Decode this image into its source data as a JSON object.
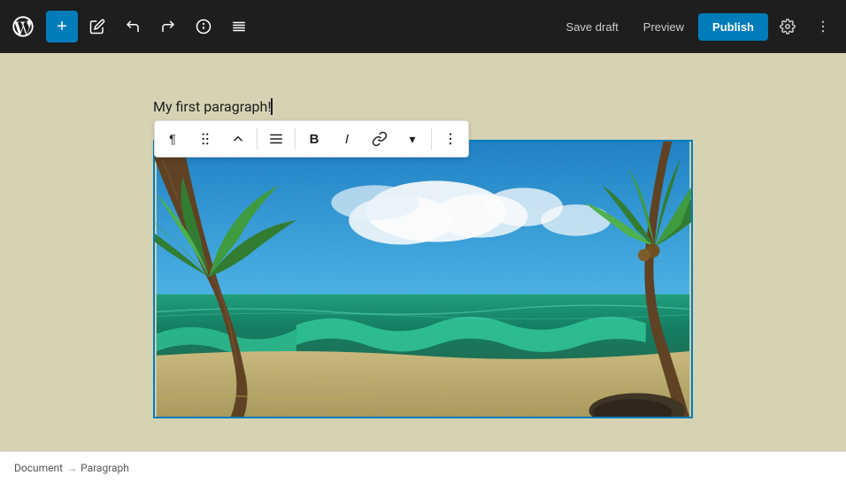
{
  "toolbar": {
    "add_label": "+",
    "save_draft_label": "Save draft",
    "preview_label": "Preview",
    "publish_label": "Publish"
  },
  "block_toolbar": {
    "paragraph_icon": "¶",
    "drag_icon": "⠿",
    "align_icon": "≡",
    "bold_icon": "B",
    "italic_icon": "I",
    "link_icon": "🔗",
    "more_icon": "⋮"
  },
  "content": {
    "paragraph_text": "My first paragraph!"
  },
  "status_bar": {
    "document_label": "Document",
    "arrow": "→",
    "paragraph_label": "Paragraph"
  }
}
